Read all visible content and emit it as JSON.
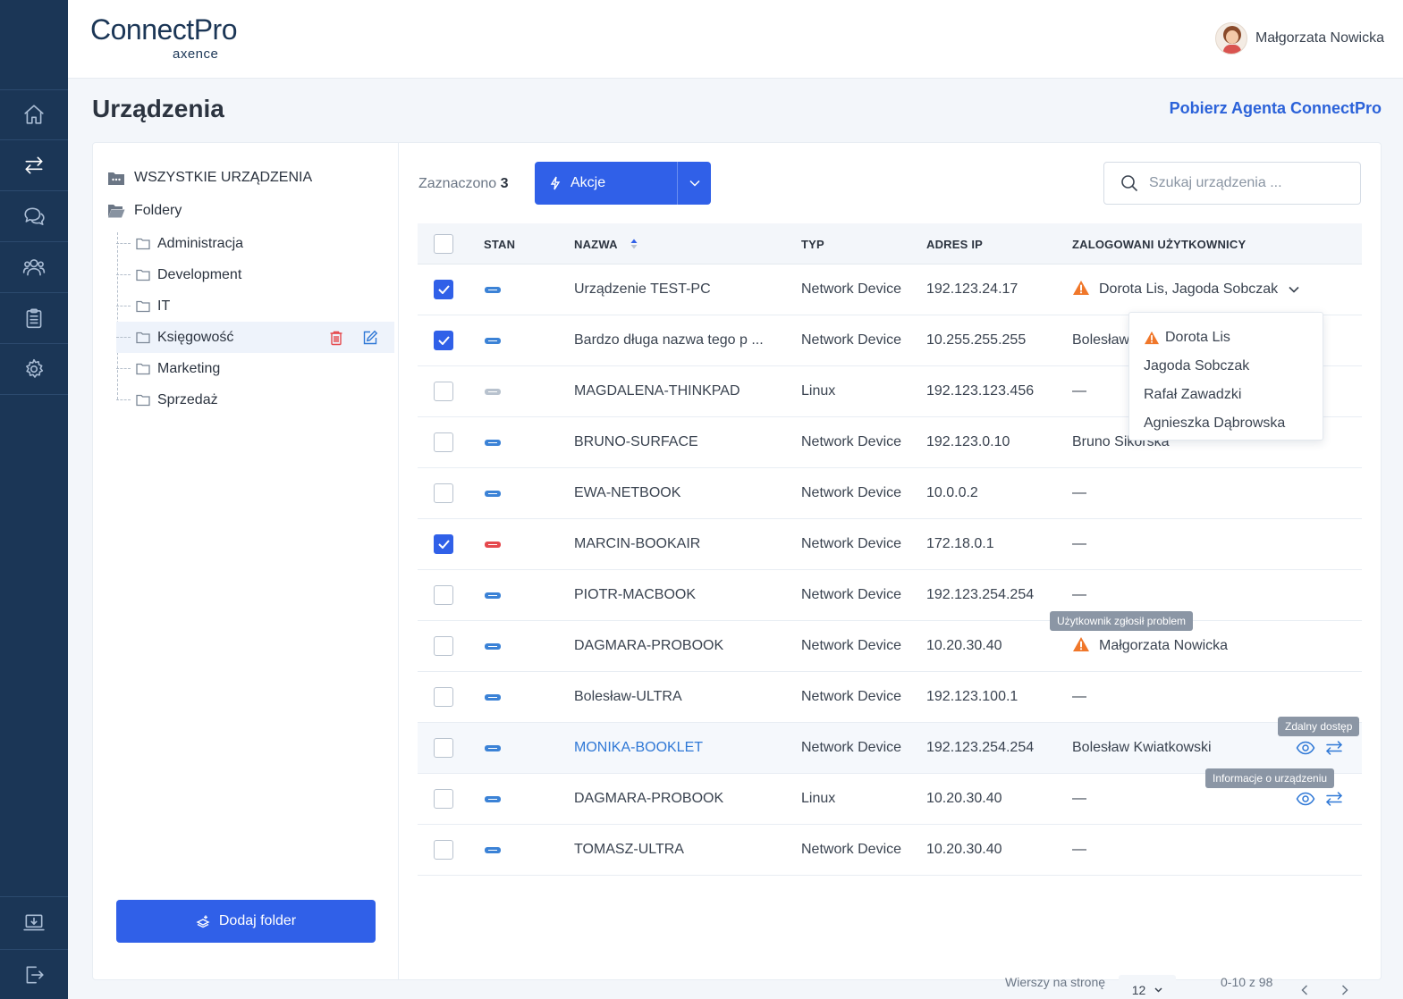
{
  "app": {
    "logo_main": "ConnectPro",
    "logo_sub": "axence",
    "user_name": "Małgorzata Nowicka"
  },
  "colors": {
    "nav_bg": "#1b3656",
    "primary": "#3060e8",
    "link": "#2f78d6",
    "warning": "#f0772a",
    "status_online": "#3b82d6",
    "status_offline": "#b8c2ce",
    "status_error": "#e5484d"
  },
  "nav": {
    "items": [
      {
        "icon": "home-icon"
      },
      {
        "icon": "remote-access-icon",
        "active": true
      },
      {
        "icon": "chat-icon"
      },
      {
        "icon": "users-icon"
      },
      {
        "icon": "clipboard-icon"
      },
      {
        "icon": "gear-icon"
      }
    ],
    "bottom": [
      {
        "icon": "download-agent-icon"
      },
      {
        "icon": "logout-icon"
      }
    ]
  },
  "page": {
    "title": "Urządzenia",
    "download_link": "Pobierz Agenta ConnectPro"
  },
  "sidebar": {
    "all_devices": "WSZYSTKIE URZĄDZENIA",
    "folders_label": "Foldery",
    "folders": [
      {
        "label": "Administracja"
      },
      {
        "label": "Development"
      },
      {
        "label": "IT"
      },
      {
        "label": "Księgowość",
        "selected": true
      },
      {
        "label": "Marketing"
      },
      {
        "label": "Sprzedaż"
      }
    ],
    "add_folder": "Dodaj folder"
  },
  "toolbar": {
    "selected_label": "Zaznaczono",
    "selected_count": "3",
    "actions_label": "Akcje",
    "search_placeholder": "Szukaj urządzenia ..."
  },
  "table": {
    "columns": {
      "status": "STAN",
      "name": "NAZWA",
      "type": "TYP",
      "ip": "ADRES IP",
      "users": "ZALOGOWANI UŻYTKOWNICY"
    },
    "rows": [
      {
        "checked": true,
        "status": "online",
        "name": "Urządzenie TEST-PC",
        "type": "Network Device",
        "ip": "192.123.24.17",
        "users": "Dorota Lis, Jagoda Sobczak",
        "warning": true,
        "expand": true
      },
      {
        "checked": true,
        "status": "online",
        "name": "Bardzo długa nazwa tego p ...",
        "type": "Network Device",
        "ip": "10.255.255.255",
        "users": "Bolesław"
      },
      {
        "checked": false,
        "status": "offline",
        "name": "MAGDALENA-THINKPAD",
        "type": "Linux",
        "ip": "192.123.123.456",
        "users": "—"
      },
      {
        "checked": false,
        "status": "online",
        "name": "BRUNO-SURFACE",
        "type": "Network Device",
        "ip": "192.123.0.10",
        "users": "Bruno Sikorska"
      },
      {
        "checked": false,
        "status": "online",
        "name": "EWA-NETBOOK",
        "type": "Network Device",
        "ip": "10.0.0.2",
        "users": "—"
      },
      {
        "checked": true,
        "status": "error",
        "name": "MARCIN-BOOKAIR",
        "type": "Network Device",
        "ip": "172.18.0.1",
        "users": "—"
      },
      {
        "checked": false,
        "status": "online",
        "name": "PIOTR-MACBOOK",
        "type": "Network Device",
        "ip": "192.123.254.254",
        "users": "—"
      },
      {
        "checked": false,
        "status": "online",
        "name": "DAGMARA-PROBOOK",
        "type": "Network Device",
        "ip": "10.20.30.40",
        "users": "Małgorzata Nowicka",
        "warning": true
      },
      {
        "checked": false,
        "status": "online",
        "name": "Bolesław-ULTRA",
        "type": "Network Device",
        "ip": "192.123.100.1",
        "users": "—"
      },
      {
        "checked": false,
        "status": "online",
        "name": "MONIKA-BOOKLET",
        "type": "Network Device",
        "ip": "192.123.254.254",
        "users": "Bolesław Kwiatkowski",
        "hover": true,
        "icons": true
      },
      {
        "checked": false,
        "status": "online",
        "name": "DAGMARA-PROBOOK",
        "type": "Linux",
        "ip": "10.20.30.40",
        "users": "—",
        "icons": true
      },
      {
        "checked": false,
        "status": "online",
        "name": "TOMASZ-ULTRA",
        "type": "Network Device",
        "ip": "10.20.30.40",
        "users": "—"
      }
    ]
  },
  "users_dropdown": {
    "options": [
      {
        "label": "Dorota Lis",
        "warning": true
      },
      {
        "label": "Jagoda Sobczak"
      },
      {
        "label": "Rafał Zawadzki"
      },
      {
        "label": "Agnieszka Dąbrowska"
      }
    ]
  },
  "tooltips": {
    "user_problem": "Użytkownik zgłosił problem",
    "remote_access": "Zdalny dostęp",
    "device_info": "Informacje o urządzeniu"
  },
  "pagination": {
    "rows_per_page_label": "Wierszy na stronę",
    "rows_per_page": "12",
    "range": "0-10 z 98"
  }
}
